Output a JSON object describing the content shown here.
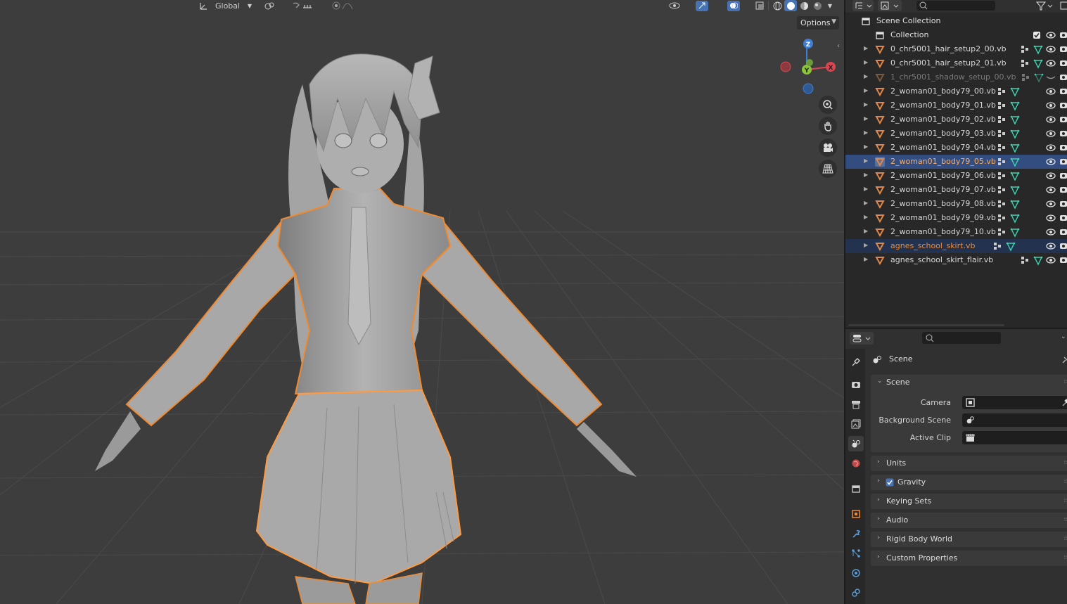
{
  "viewport": {
    "header": {
      "transform_orientation": "Global"
    },
    "options_label": "Options",
    "gizmo": {
      "z_label": "Z",
      "y_label": "Y",
      "x_label": "X"
    }
  },
  "outliner": {
    "root": "Scene Collection",
    "collection": "Collection",
    "items": [
      {
        "label": "0_chr5001_hair_setup2_00.vb",
        "state": "normal"
      },
      {
        "label": "0_chr5001_hair_setup2_01.vb",
        "state": "normal"
      },
      {
        "label": "1_chr5001_shadow_setup_00.vb",
        "state": "hidden"
      },
      {
        "label": "2_woman01_body79_00.vb",
        "state": "normal"
      },
      {
        "label": "2_woman01_body79_01.vb",
        "state": "normal"
      },
      {
        "label": "2_woman01_body79_02.vb",
        "state": "normal"
      },
      {
        "label": "2_woman01_body79_03.vb",
        "state": "normal"
      },
      {
        "label": "2_woman01_body79_04.vb",
        "state": "normal"
      },
      {
        "label": "2_woman01_body79_05.vb",
        "state": "active"
      },
      {
        "label": "2_woman01_body79_06.vb",
        "state": "normal"
      },
      {
        "label": "2_woman01_body79_07.vb",
        "state": "normal"
      },
      {
        "label": "2_woman01_body79_08.vb",
        "state": "normal"
      },
      {
        "label": "2_woman01_body79_09.vb",
        "state": "normal"
      },
      {
        "label": "2_woman01_body79_10.vb",
        "state": "normal"
      },
      {
        "label": "agnes_school_skirt.vb",
        "state": "selected"
      },
      {
        "label": "agnes_school_skirt_flair.vb",
        "state": "normal"
      }
    ]
  },
  "properties": {
    "context_title": "Scene",
    "scene_panel": {
      "title": "Scene",
      "fields": [
        {
          "label": "Camera",
          "value": ""
        },
        {
          "label": "Background Scene",
          "value": ""
        },
        {
          "label": "Active Clip",
          "value": ""
        }
      ]
    },
    "panels": [
      {
        "title": "Units",
        "checkbox": false
      },
      {
        "title": "Gravity",
        "checkbox": true,
        "checked": true
      },
      {
        "title": "Keying Sets",
        "checkbox": false
      },
      {
        "title": "Audio",
        "checkbox": false
      },
      {
        "title": "Rigid Body World",
        "checkbox": false
      },
      {
        "title": "Custom Properties",
        "checkbox": false
      }
    ]
  },
  "colors": {
    "selection_orange": "#f08a30",
    "active_highlight": "#334d80",
    "selected_highlight": "#22324f",
    "mesh_icon": "#e0894a",
    "axis_x": "#e0454f",
    "axis_y": "#8ac53a",
    "axis_z": "#3f7ed3"
  }
}
